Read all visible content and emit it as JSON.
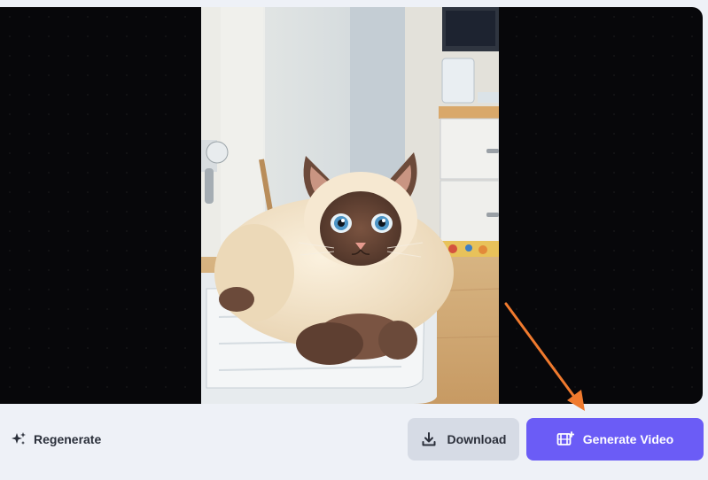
{
  "actions": {
    "regenerate_label": "Regenerate",
    "download_label": "Download",
    "generate_video_label": "Generate Video"
  },
  "icons": {
    "regenerate": "sparkles-icon",
    "download": "download-icon",
    "generate_video": "film-plus-icon"
  },
  "colors": {
    "accent": "#6b5cf6",
    "annotation_arrow": "#f07a2e",
    "stage_background": "#07070a"
  }
}
